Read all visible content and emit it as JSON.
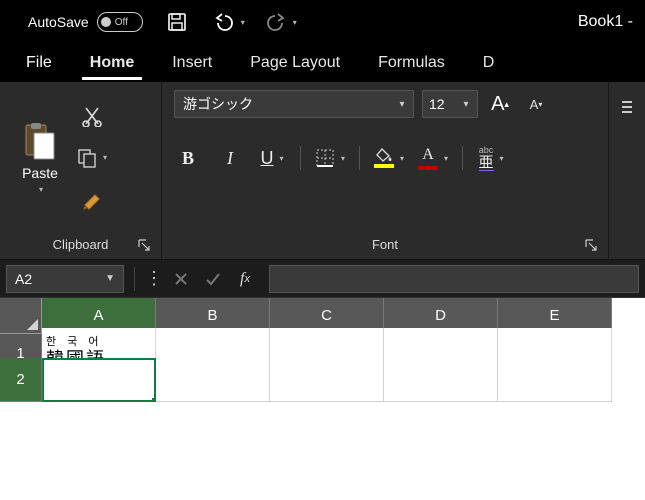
{
  "titlebar": {
    "autosave_label": "AutoSave",
    "autosave_state": "Off",
    "doc_title": "Book1 -"
  },
  "tabs": {
    "file": "File",
    "home": "Home",
    "insert": "Insert",
    "page_layout": "Page Layout",
    "formulas": "Formulas",
    "data_partial": "D"
  },
  "clipboard": {
    "paste_label": "Paste",
    "group_label": "Clipboard"
  },
  "font": {
    "font_name": "游ゴシック",
    "font_size": "12",
    "group_label": "Font",
    "highlight_color": "#ffff00",
    "font_color": "#c00000"
  },
  "name_box": "A2",
  "columns": [
    "A",
    "B",
    "C",
    "D",
    "E"
  ],
  "rows": [
    "1",
    "2"
  ],
  "cells": {
    "A1_phonetic": "한 국 어",
    "A1_base": "韓國語"
  },
  "icons": {
    "increase_font": "A",
    "decrease_font": "A",
    "bold": "B",
    "italic": "I",
    "underline": "U",
    "ruby": "abc"
  }
}
